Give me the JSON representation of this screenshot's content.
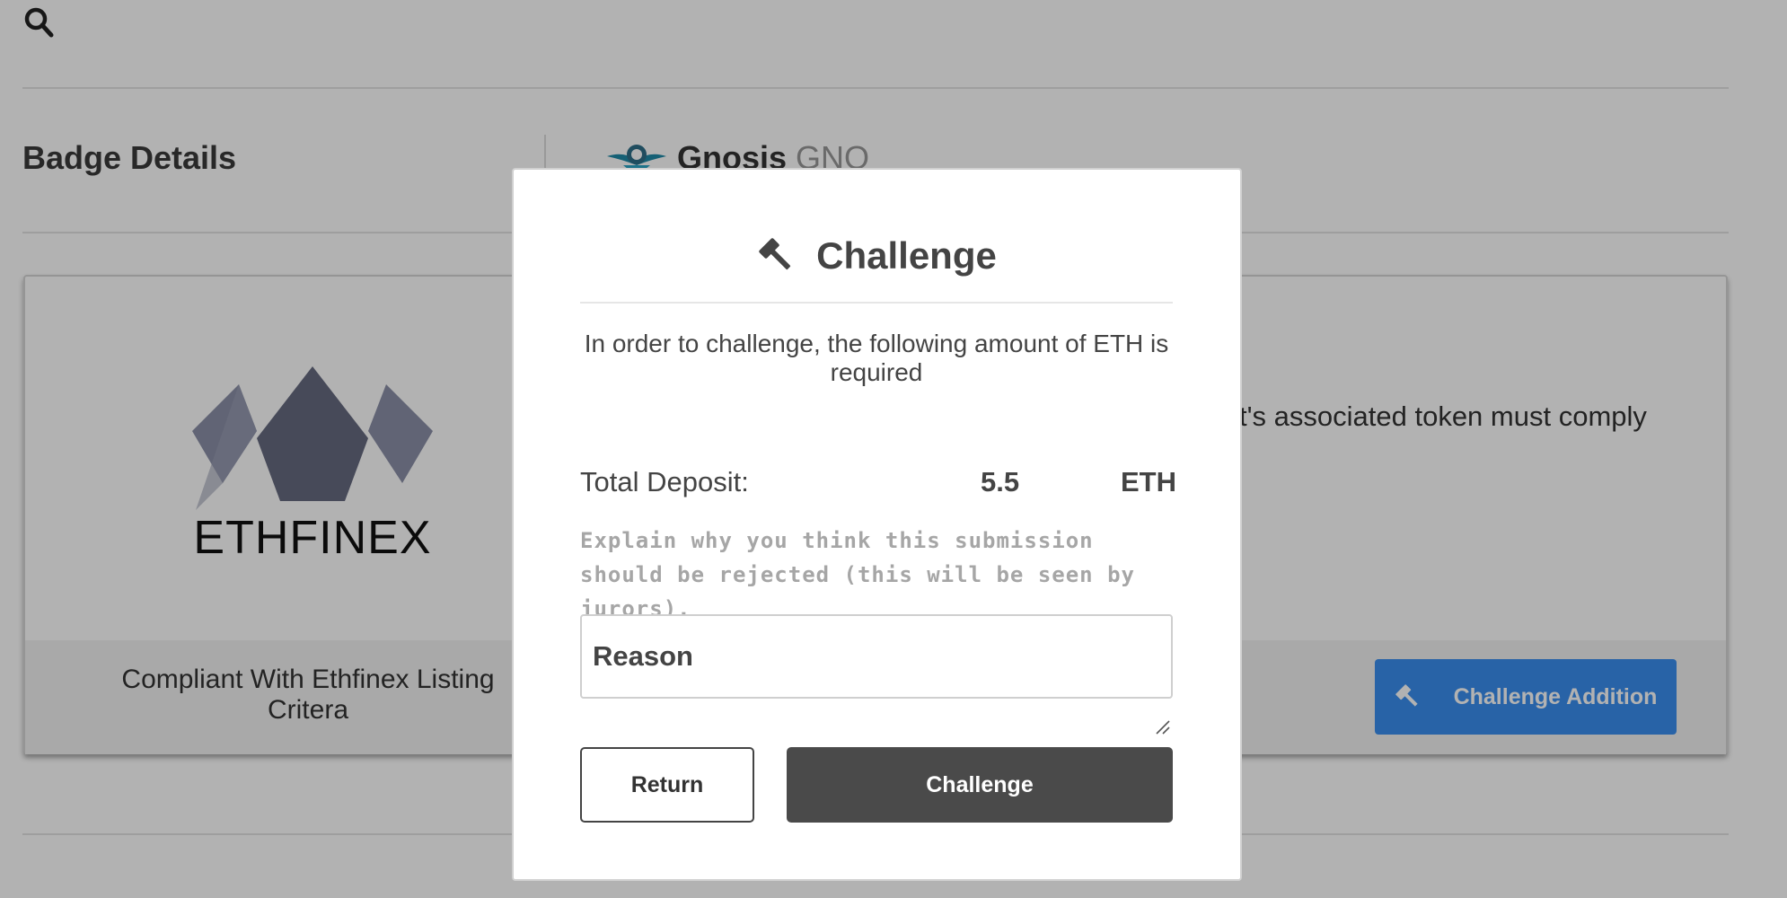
{
  "header": {
    "search_icon": "search-icon"
  },
  "badge": {
    "title": "Badge Details",
    "token_name": "Gnosis",
    "token_ticker": "GNO",
    "card": {
      "logo_text": "ETHFINEX",
      "compliance_label": "Compliant With Ethfinex Listing Critera",
      "criteria_text": "t's associated token must comply",
      "challenge_addition_label": "Challenge Addition"
    }
  },
  "modal": {
    "title": "Challenge",
    "description": "In order to challenge, the following amount of ETH is required",
    "deposit_label": "Total Deposit:",
    "deposit_amount": "5.5",
    "deposit_unit": "ETH",
    "explain_text": "Explain why you think this submission should be rejected (this will be seen by jurors).",
    "reason_placeholder": "Reason",
    "return_label": "Return",
    "challenge_label": "Challenge"
  },
  "colors": {
    "accent_blue": "#3a8ff0",
    "dark_button": "#4a4a4a",
    "overlay": "rgba(0,0,0,0.30)"
  }
}
